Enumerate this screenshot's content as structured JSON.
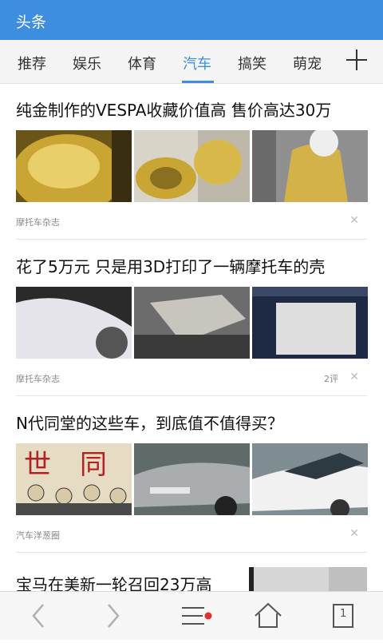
{
  "header": {
    "title": "头条"
  },
  "tabs": [
    {
      "label": "推荐"
    },
    {
      "label": "娱乐"
    },
    {
      "label": "体育"
    },
    {
      "label": "汽车",
      "active": true
    },
    {
      "label": "搞笑"
    },
    {
      "label": "萌宠"
    }
  ],
  "articles": [
    {
      "title": "纯金制作的VESPA收藏价值高 售价高达30万",
      "source": "摩托车杂志",
      "comments": ""
    },
    {
      "title": "花了5万元 只是用3D打印了一辆摩托车的壳",
      "source": "摩托车杂志",
      "comments": "2评"
    },
    {
      "title": "N代同堂的这些车，到底值不值得买？",
      "source": "汽车洋葱圈",
      "comments": ""
    },
    {
      "title": "宝马在美新一轮召回23万高",
      "source": "",
      "comments": ""
    }
  ],
  "tab_count": "1",
  "colors": {
    "accent": "#3d8de0",
    "notification_dot": "#e03030"
  }
}
